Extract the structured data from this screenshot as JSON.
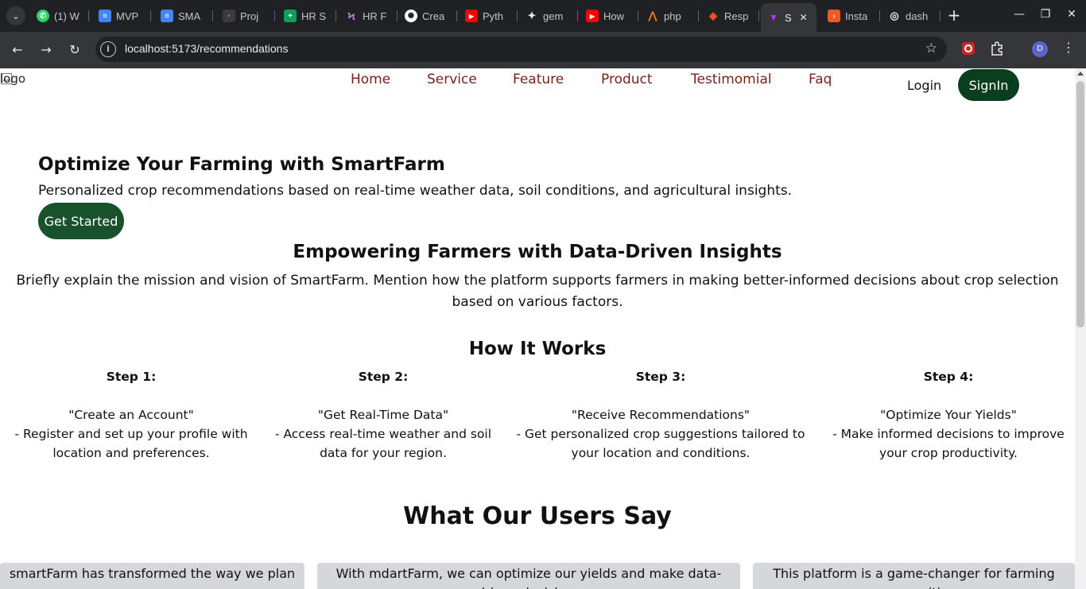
{
  "browser": {
    "tabs": [
      {
        "title": "(1) W",
        "icon": "whatsapp-icon",
        "color": "#25d366",
        "glyph": "✆"
      },
      {
        "title": "MVP",
        "icon": "docs-icon",
        "color": "#4285f4",
        "glyph": "≡"
      },
      {
        "title": "SMA",
        "icon": "docs-icon",
        "color": "#4285f4",
        "glyph": "≡"
      },
      {
        "title": "Proj",
        "icon": "project-icon",
        "color": "#3c3c3c",
        "glyph": "•"
      },
      {
        "title": "HR S",
        "icon": "sheets-icon",
        "color": "#0f9d58",
        "glyph": "+"
      },
      {
        "title": "HR F",
        "icon": "figure-icon",
        "color": "#9b59b6",
        "glyph": "Ϟ"
      },
      {
        "title": "Crea",
        "icon": "openai-icon",
        "color": "#ffffff",
        "glyph": "✺"
      },
      {
        "title": "Pyth",
        "icon": "youtube-icon",
        "color": "#ff0000",
        "glyph": "▶"
      },
      {
        "title": "gem",
        "icon": "gemini-icon",
        "color": "#202124",
        "glyph": "✦"
      },
      {
        "title": "How",
        "icon": "youtube-icon",
        "color": "#ff0000",
        "glyph": "▶"
      },
      {
        "title": "php",
        "icon": "xampp-icon",
        "color": "#fb7a24",
        "glyph": "⋀"
      },
      {
        "title": "Resp",
        "icon": "figma-icon",
        "color": "#f24e1e",
        "glyph": "◆"
      },
      {
        "title": "S",
        "icon": "vite-icon",
        "color": "#bd34fe",
        "glyph": "▼",
        "active": true
      },
      {
        "title": "Insta",
        "icon": "postman-icon",
        "color": "#ef5b25",
        "glyph": "›"
      },
      {
        "title": "dash",
        "icon": "dashboard-icon",
        "color": "#202124",
        "glyph": "◎"
      }
    ],
    "url": "localhost:5173/recommendations",
    "profile_initial": "D",
    "colors": {
      "tab_strip": "#202124",
      "toolbar": "#35363a"
    }
  },
  "page": {
    "logo_alt": "logo",
    "nav": [
      "Home",
      "Service",
      "Feature",
      "Product",
      "Testimomial",
      "Faq"
    ],
    "login_label": "Login",
    "signin_label": "SignIn",
    "hero": {
      "title": "Optimize Your Farming with SmartFarm",
      "subtitle": "Personalized crop recommendations based on real-time weather data, soil conditions, and agricultural insights.",
      "cta_label": "Get Started"
    },
    "mission": {
      "title": "Empowering Farmers with Data-Driven Insights",
      "text": "Briefly explain the mission and vision of SmartFarm. Mention how the platform supports farmers in making better-informed decisions about crop selection based on various factors."
    },
    "how": {
      "title": "How It Works",
      "steps": [
        {
          "label": "Step 1:",
          "name": "\"Create an Account\"",
          "desc": "- Register and set up your profile with location and preferences."
        },
        {
          "label": "Step 2:",
          "name": "\"Get Real-Time Data\"",
          "desc": "- Access real-time weather and soil data for your region."
        },
        {
          "label": "Step 3:",
          "name": "\"Receive Recommendations\"",
          "desc": "- Get personalized crop suggestions tailored to your location and conditions."
        },
        {
          "label": "Step 4:",
          "name": "\"Optimize Your Yields\"",
          "desc": "- Make informed decisions to improve your crop productivity."
        }
      ]
    },
    "testimonials": {
      "title": "What Our Users Say",
      "cards": [
        "smartFarm has transformed the way we plan our",
        "With mdartFarm, we can optimize our yields and make data-driven decisions",
        "This platform is a game-changer for farming communities"
      ]
    },
    "colors": {
      "nav_text": "#7a1f1a",
      "signin_bg": "#0b3d1f",
      "cta_bg": "#17522d",
      "card_bg": "#d5d7db"
    }
  }
}
